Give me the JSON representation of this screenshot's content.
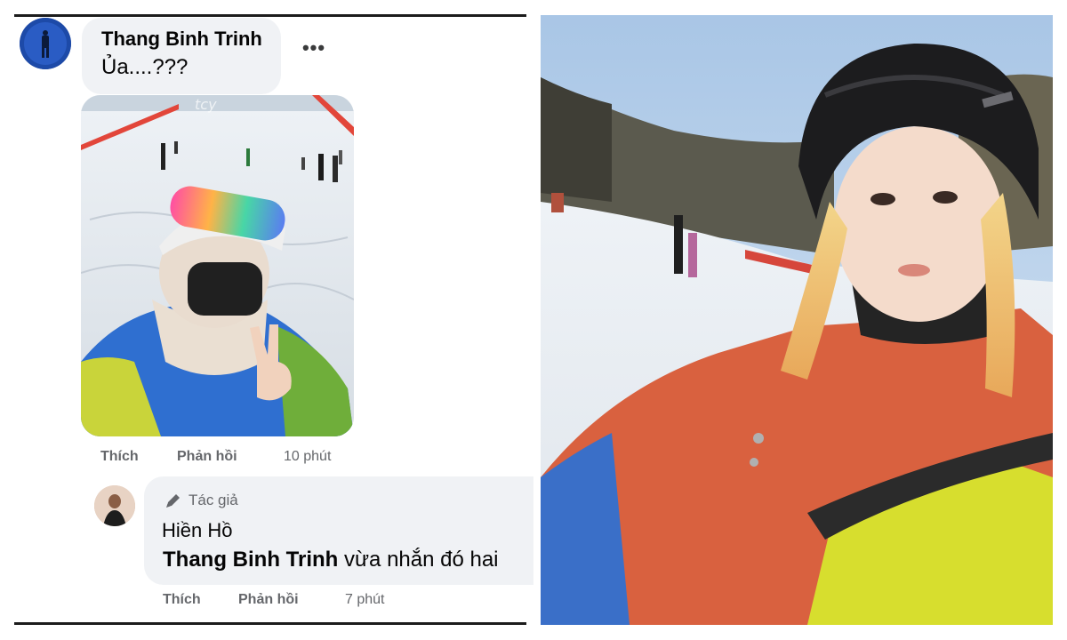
{
  "comment": {
    "author": "Thang Binh Trinh",
    "text": "Ủa....???",
    "more_label": "•••",
    "actions": {
      "like": "Thích",
      "reply": "Phản hồi",
      "time": "10 phút"
    }
  },
  "reply": {
    "badge": "Tác giả",
    "author": "Hiền Hồ",
    "mention": "Thang Binh Trinh",
    "text": " vừa nhắn đó hai",
    "actions": {
      "like": "Thích",
      "reply": "Phản hồi",
      "time": "7 phút"
    }
  },
  "attachment": {
    "watermark": "tcy"
  },
  "icons": {
    "more": "more-options-icon",
    "badge": "pencil-icon"
  },
  "colors": {
    "bubble": "#f0f2f5",
    "secondary_text": "#65676b",
    "primary_text": "#050505"
  }
}
